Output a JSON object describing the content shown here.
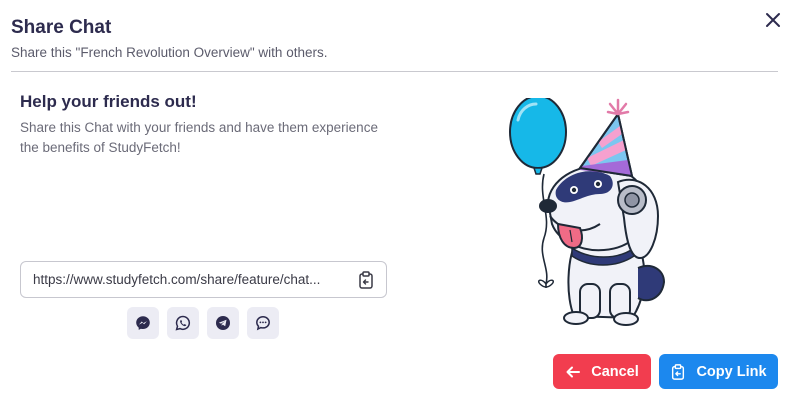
{
  "dialog": {
    "title": "Share Chat",
    "subtitle": "Share this \"French Revolution Overview\" with others."
  },
  "content": {
    "heading": "Help your friends out!",
    "description": "Share this Chat with your friends and have them experience the benefits of StudyFetch!"
  },
  "link": {
    "url": "https://www.studyfetch.com/share/feature/chat..."
  },
  "share_icons": [
    "messenger-icon",
    "whatsapp-icon",
    "telegram-icon",
    "sms-icon"
  ],
  "actions": {
    "cancel_label": "Cancel",
    "copy_label": "Copy Link"
  },
  "colors": {
    "cancel": "#f23d4f",
    "primary": "#1c88ee",
    "title": "#2d2b4e"
  }
}
